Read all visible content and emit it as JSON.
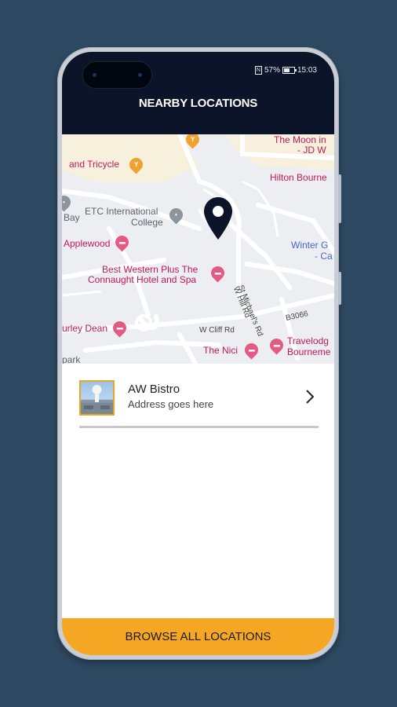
{
  "status_bar": {
    "sim": "N",
    "battery_percent": "57%",
    "time": "15:03",
    "battery_level": 0.57
  },
  "header": {
    "title": "NEARBY LOCATIONS"
  },
  "map": {
    "labels": {
      "moon": "The Moon in",
      "jdw": "- JD W",
      "tricycle": "and Tricycle",
      "hilton": "Hilton Bourne",
      "bay": "Bay",
      "etc_1": "ETC International",
      "etc_2": "College",
      "applewood": "Applewood",
      "winter_1": "Winter G",
      "winter_2": "- Ca",
      "bw_1": "Best Western Plus The",
      "bw_2": "Connaught Hotel and Spa",
      "st_michaels": "St Michael's Rd",
      "w_hill": "W Hill Rd",
      "b3066": "B3066",
      "urley": "urley Dean",
      "w_cliff": "W Cliff Rd",
      "nici": "The Nici",
      "travelodge_1": "Travelodg",
      "travelodge_2": "Bourneme",
      "park": "park"
    }
  },
  "locations": [
    {
      "name": "AW Bistro",
      "address": "Address goes here"
    }
  ],
  "footer": {
    "browse_label": "BROWSE ALL LOCATIONS"
  },
  "colors": {
    "header_bg": "#0b1428",
    "accent": "#f5a623",
    "background": "#2e4a63"
  }
}
